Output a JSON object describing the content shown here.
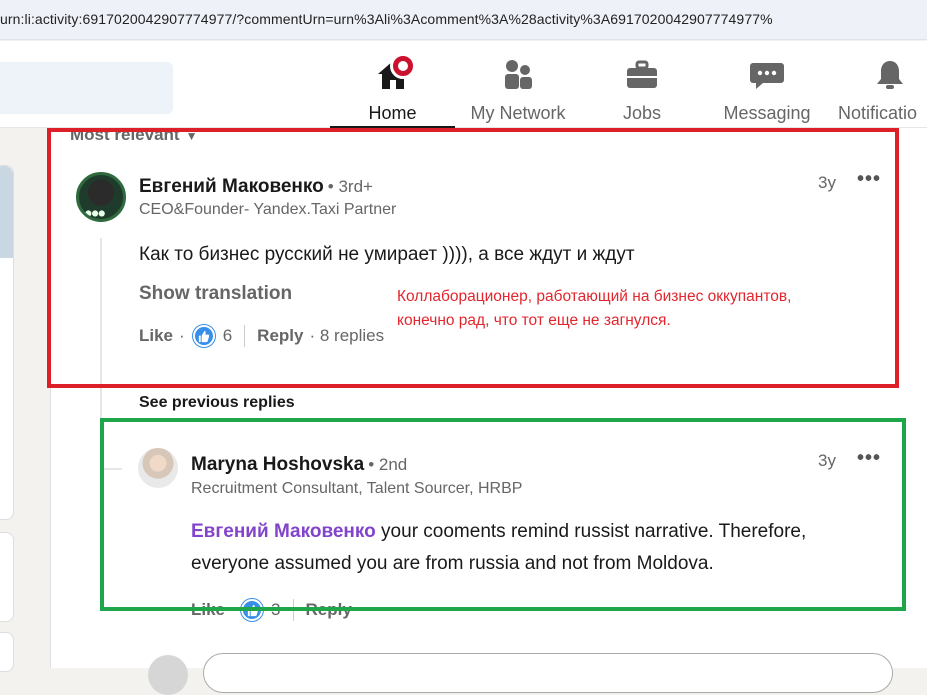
{
  "browser": {
    "url": "urn:li:activity:6917020042907774977/?commentUrn=urn%3Ali%3Acomment%3A%28activity%3A6917020042907774977%"
  },
  "nav": {
    "items": [
      {
        "label": "Home",
        "icon": "home-icon",
        "active": true
      },
      {
        "label": "My Network",
        "icon": "people-icon"
      },
      {
        "label": "Jobs",
        "icon": "briefcase-icon"
      },
      {
        "label": "Messaging",
        "icon": "chat-icon"
      },
      {
        "label": "Notificatio",
        "icon": "bell-icon"
      }
    ]
  },
  "sort": {
    "label": "Most relevant"
  },
  "comment": {
    "author": "Евгений Маковенко",
    "degree": "• 3rd+",
    "headline": "CEO&Founder- Yandex.Taxi Partner",
    "time": "3y",
    "text": "Как то бизнес русский не умирает )))), а все ждут и ждут",
    "show_translation": "Show translation",
    "like_label": "Like",
    "like_sep": "·",
    "reactions_count": "6",
    "reply_label": "Reply",
    "replies_text": "· 8 replies"
  },
  "annotation": {
    "line1": "Коллаборационер, работающий на бизнес оккупантов,",
    "line2": "конечно рад, что тот еще не загнулся."
  },
  "see_previous": "See previous replies",
  "reply": {
    "author": "Maryna Hoshovska",
    "degree": "• 2nd",
    "headline": "Recruitment Consultant, Talent Sourcer, HRBP",
    "time": "3y",
    "mention": "Евгений Маковенко",
    "text_line1_rest": " your cooments remind russist narrative. Therefore,",
    "text_line2": "everyone assumed you are from russia and not from Moldova.",
    "like_label": "Like",
    "reactions_count": "3",
    "reply_label": "Reply"
  },
  "colors": {
    "red_box": "#dd1f2a",
    "green_box": "#1fa64a",
    "annotation": "#e2262e",
    "mention": "#8344cc",
    "reaction": "#378fe9"
  }
}
